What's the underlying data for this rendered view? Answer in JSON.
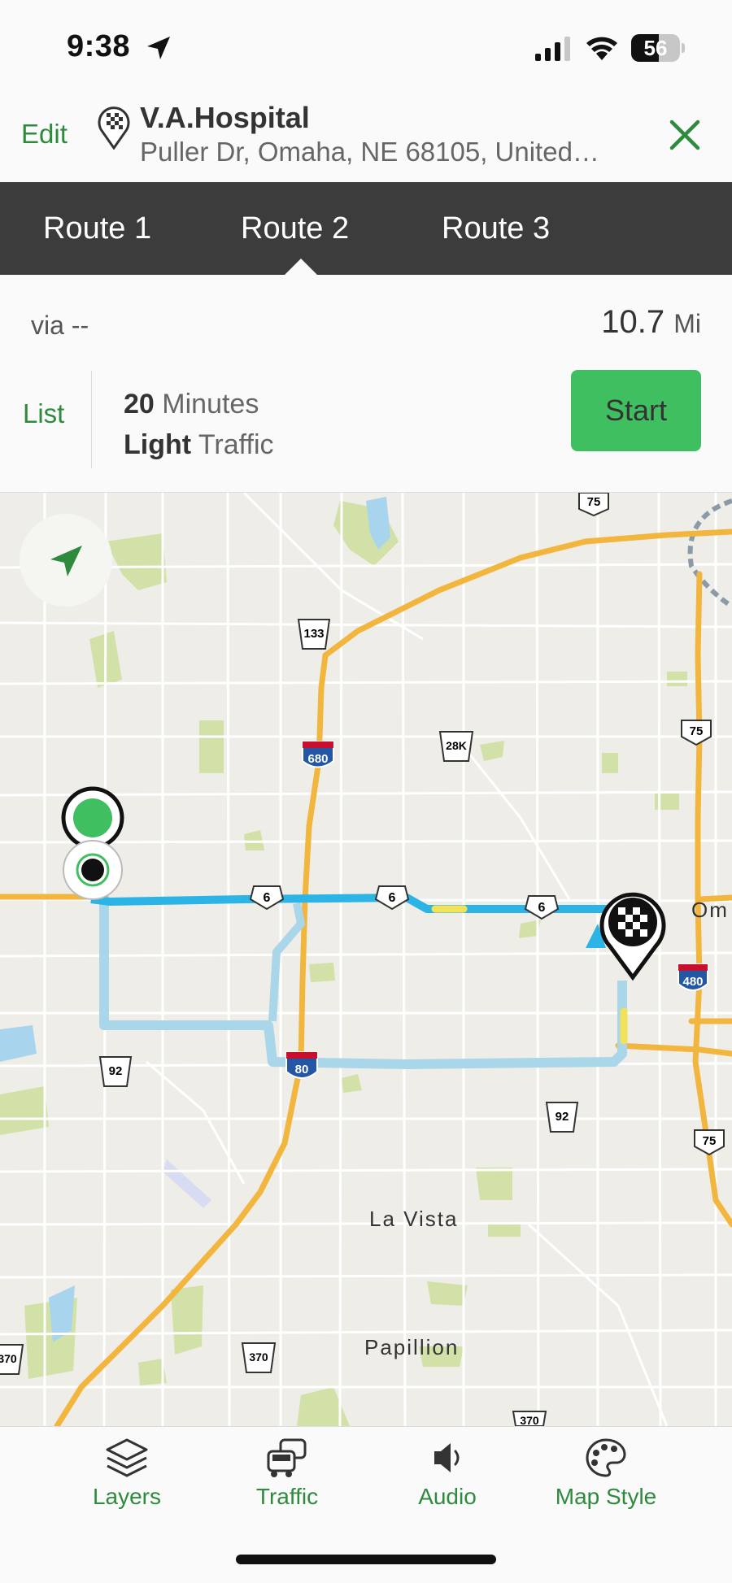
{
  "status_bar": {
    "time": "9:38",
    "battery": "56",
    "battery_level": 0.56
  },
  "destination": {
    "edit_label": "Edit",
    "name": "V.A.Hospital",
    "address": "Puller Dr, Omaha, NE 68105, United…"
  },
  "routes": {
    "tabs": [
      {
        "label": "Route 1"
      },
      {
        "label": "Route 2"
      },
      {
        "label": "Route 3"
      }
    ],
    "selected_tab": "Route 2"
  },
  "summary": {
    "via_label": "via --",
    "distance_value": "10.7",
    "distance_unit": "Mi",
    "list_label": "List",
    "duration_value": "20",
    "duration_unit": "Minutes",
    "traffic_level": "Light",
    "traffic_label": "Traffic",
    "start_label": "Start"
  },
  "map": {
    "places": {
      "la_vista": "La Vista",
      "papillion": "Papillion",
      "omaha": "Om"
    },
    "shields": {
      "s75_top": "75",
      "s133": "133",
      "s680": "680",
      "s28k": "28K",
      "s75_right": "75",
      "s6_a": "6",
      "s6_b": "6",
      "s6_c": "6",
      "s480": "480",
      "s80": "80",
      "s92_left": "92",
      "s92_right": "92",
      "s75_low": "75",
      "s370_left": "370",
      "s370_mid": "370",
      "s370_bottom": "370"
    },
    "colors": {
      "land": "#eeede7",
      "road": "#ffffff",
      "highway": "#f2b53d",
      "park": "#d2e1a8",
      "water": "#a9d4ee",
      "route_active": "#2cb4e6",
      "route_alt": "#a9d6e9",
      "traffic_moderate": "#f0e35a"
    }
  },
  "toolbar": {
    "items": [
      {
        "label": "Layers",
        "icon": "layers-icon"
      },
      {
        "label": "Traffic",
        "icon": "traffic-icon"
      },
      {
        "label": "Audio",
        "icon": "speaker-icon"
      },
      {
        "label": "Map Style",
        "icon": "palette-icon"
      }
    ]
  },
  "accent_color": "#2e8b3d",
  "start_button_color": "#3fbf5f"
}
